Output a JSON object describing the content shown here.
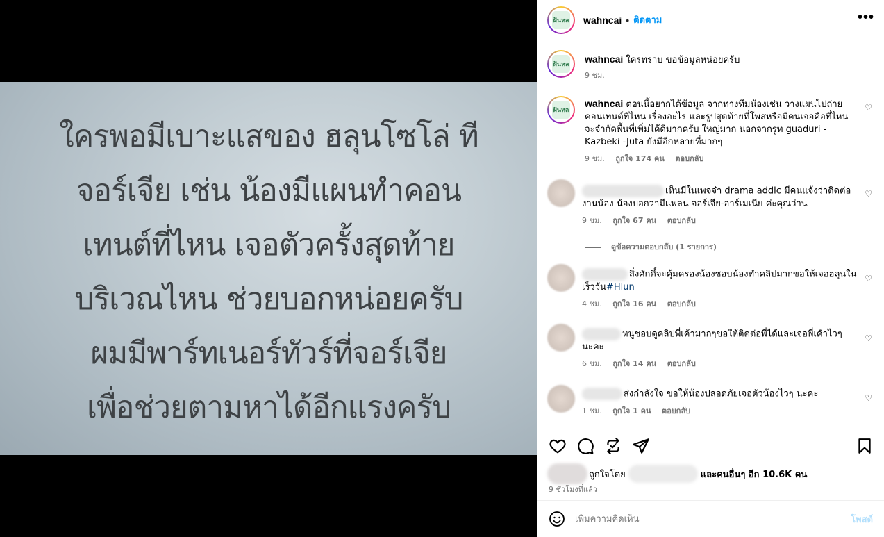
{
  "media": {
    "lines": [
      "ใครพอมีเบาะแสของ ฮลุนโซโล่ ที",
      "จอร์เจีย เช่น น้องมีแผนทำคอน",
      "เทนต์ที่ไหน เจอตัวครั้งสุดท้าย",
      "บริเวณไหน ช่วยบอกหน่อยครับ",
      "ผมมีพาร์ทเนอร์ทัวร์ที่จอร์เจีย",
      "เพื่อช่วยตามหาได้อีกแรงครับ"
    ]
  },
  "header": {
    "username": "wahncai",
    "dot": "•",
    "follow_label": "ติดตาม",
    "more_label": "•••",
    "avatar_text": "ฝันหล"
  },
  "caption": {
    "username": "wahncai",
    "text": "ใครทราบ ขอข้อมูลหน่อยครับ",
    "time": "9 ชม."
  },
  "comments": [
    {
      "username": "wahncai",
      "text": "ตอนนี้อยากได้ข้อมูล จากทางทีมน้องเช่น วางแผนไปถ่ายคอนเทนต์ที่ไหน เรื่องอะไร และรูปสุดท้ายที่โพสหรือมีคนเจอคือที่ไหน จะจำกัดพื้นที่เพิ่มได้ดีมากครับ ใหญ่มาก นอกจากรูท guaduri - Kazbeki -Juta ยังมีอีกหลายที่มากๆ",
      "time": "9 ชม.",
      "likes": "ถูกใจ 174 คน",
      "reply": "ตอบกลับ"
    },
    {
      "text": "เห็นมีในเพจจ๋า drama addic มีคนแจ้งว่าติดต่องานน้อง น้องบอกว่ามีแพลน จอร์เจีย-อาร์เมเนีย ค่ะคุณว่าน",
      "time": "9 ชม.",
      "likes": "ถูกใจ 67 คน",
      "reply": "ตอบกลับ",
      "view_replies": "ดูข้อความตอบกลับ (1 รายการ)"
    },
    {
      "text": "สิ่งศักดิ์จะคุ้มครองน้องชอบน้องทำคลิปมากขอให้เจอฮลุนในเร็ววัน",
      "hashtag": "#Hlun",
      "time": "4 ชม.",
      "likes": "ถูกใจ 16 คน",
      "reply": "ตอบกลับ"
    },
    {
      "text": "หนูชอบดูคลิปพี่เค้ามากๆขอให้ติดต่อพี่ได้และเจอพี่เค้าไวๆ นะคะ",
      "time": "6 ชม.",
      "likes": "ถูกใจ 14 คน",
      "reply": "ตอบกลับ"
    },
    {
      "text": "ส่งกำลังใจ ขอให้น้องปลอดภัยเจอตัวน้องไวๆ นะคะ",
      "time": "1 ชม.",
      "likes": "ถูกใจ 1 คน",
      "reply": "ตอบกลับ"
    }
  ],
  "likes_line": {
    "prefix": "ถูกใจโดย",
    "suffix": "และคนอื่นๆ อีก 10.6K คน"
  },
  "time_ago": "9 ชั่วโมงที่แล้ว",
  "add_comment": {
    "placeholder": "เพิ่มความคิดเห็น",
    "post_label": "โพสต์"
  }
}
